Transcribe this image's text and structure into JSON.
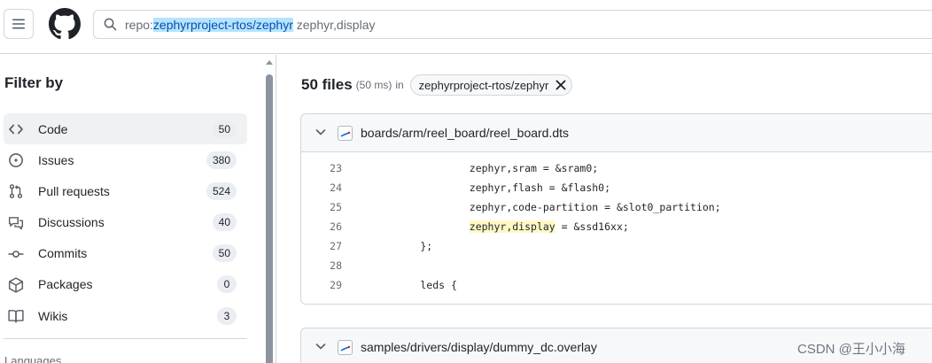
{
  "header": {
    "search": {
      "prefix": "repo:",
      "repo": "zephyrproject-rtos/zephyr",
      "terms": " zephyr,display"
    }
  },
  "sidebar": {
    "title": "Filter by",
    "items": [
      {
        "label": "Code",
        "count": "50",
        "icon": "code-icon",
        "active": true
      },
      {
        "label": "Issues",
        "count": "380",
        "icon": "issue-icon"
      },
      {
        "label": "Pull requests",
        "count": "524",
        "icon": "pull-request-icon"
      },
      {
        "label": "Discussions",
        "count": "40",
        "icon": "discussions-icon"
      },
      {
        "label": "Commits",
        "count": "50",
        "icon": "commit-icon"
      },
      {
        "label": "Packages",
        "count": "0",
        "icon": "package-icon"
      },
      {
        "label": "Wikis",
        "count": "3",
        "icon": "book-icon"
      }
    ],
    "languages_label": "Languages"
  },
  "results": {
    "count": "50 files",
    "time": "(50 ms)",
    "in": "in",
    "repo_chip": "zephyrproject-rtos/zephyr"
  },
  "files": [
    {
      "path": "boards/arm/reel_board/reel_board.dts",
      "lines": [
        {
          "num": "23",
          "code": "                zephyr,sram = &sram0;"
        },
        {
          "num": "24",
          "code": "                zephyr,flash = &flash0;"
        },
        {
          "num": "25",
          "code": "                zephyr,code-partition = &slot0_partition;"
        },
        {
          "num": "26",
          "code_pre": "                ",
          "code_mark": "zephyr,display",
          "code_post": " = &ssd16xx;"
        },
        {
          "num": "27",
          "code": "        };"
        },
        {
          "num": "28",
          "code": ""
        },
        {
          "num": "29",
          "code": "        leds {"
        }
      ]
    },
    {
      "path": "samples/drivers/display/dummy_dc.overlay"
    }
  ],
  "watermark": "CSDN @王小小海"
}
